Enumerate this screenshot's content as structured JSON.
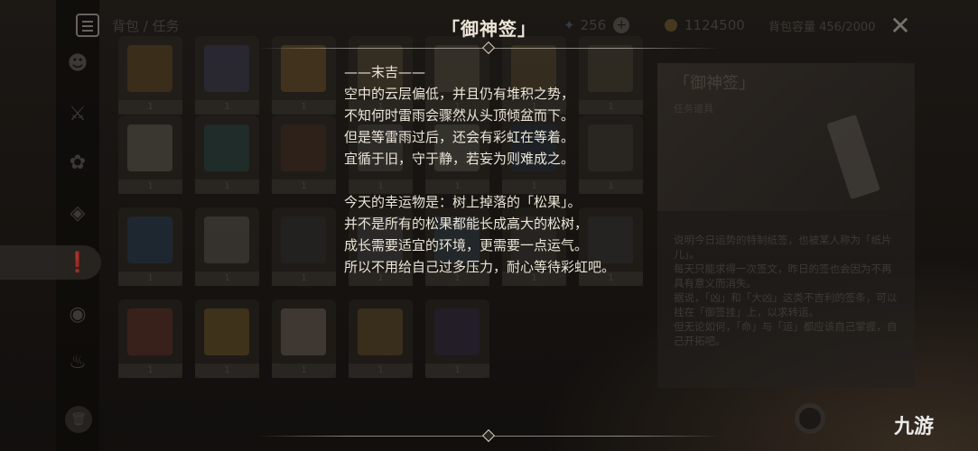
{
  "background": {
    "breadcrumb": "背包 / 任务",
    "currency_primogem": "256",
    "currency_mora": "1124500",
    "capacity": "背包容量 456/2000",
    "slot_count_label": "1",
    "detail": {
      "title": "「御神签」",
      "type": "任务道具",
      "description": [
        "说明今日运势的特制纸签，也被某人称为「纸片儿」。",
        "每天只能求得一次签文，昨日的签也会因为不再具有意义而消失。",
        "据说，「凶」和「大凶」这类不吉利的签条，可以挂在「御签挂」上，以求转运。",
        "但无论如何，「命」与「运」都应该自己掌握，自己开拓吧。"
      ]
    },
    "watermark": "九游"
  },
  "popup": {
    "title": "「御神签」",
    "lines": [
      "——末吉——",
      "空中的云层偏低，并且仍有堆积之势，",
      "不知何时雷雨会骤然从头顶倾盆而下。",
      "但是等雷雨过后，还会有彩虹在等着。",
      "宜循于旧，守于静，若妄为则难成之。",
      "",
      "今天的幸运物是：树上掉落的「松果」。",
      "并不是所有的松果都能长成高大的松树，",
      "成长需要适宜的环境，更需要一点运气。",
      "所以不用给自己过多压力，耐心等待彩虹吧。"
    ]
  },
  "icons": {
    "menu": "menu-icon",
    "close": "close-icon",
    "primogem": "primogem-icon",
    "mora": "mora-icon",
    "add": "plus-icon"
  }
}
